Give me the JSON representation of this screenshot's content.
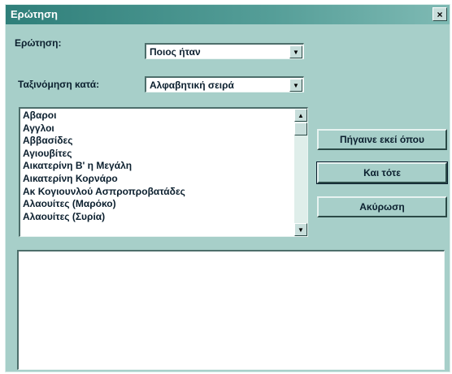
{
  "window": {
    "title": "Ερώτηση",
    "close_label": "×"
  },
  "question": {
    "label": "Ερώτηση:",
    "selected": "Ποιος ήταν"
  },
  "sort": {
    "label": "Ταξινόμηση κατά:",
    "selected": "Αλφαβητική σειρά"
  },
  "list": {
    "items": [
      "Αβαροι",
      "Αγγλοι",
      "Αββασίδες",
      "Αγιουβίτες",
      "Αικατερίνη Β' η Μεγάλη",
      "Αικατερίνη Κορνάρο",
      "Ακ Κογιουνλού Ασπροπροβατάδες",
      "Αλαουίτες (Μαρόκο)",
      "Αλαουίτες (Συρία)"
    ]
  },
  "buttons": {
    "goto": "Πήγαινε εκεί όπου",
    "then": "Και τότε",
    "cancel": "Ακύρωση"
  },
  "icons": {
    "dropdown": "▼",
    "scroll_up": "▲",
    "scroll_down": "▼"
  },
  "colors": {
    "window_bg": "#a7cfc9",
    "titlebar": "#2f7f7a"
  }
}
